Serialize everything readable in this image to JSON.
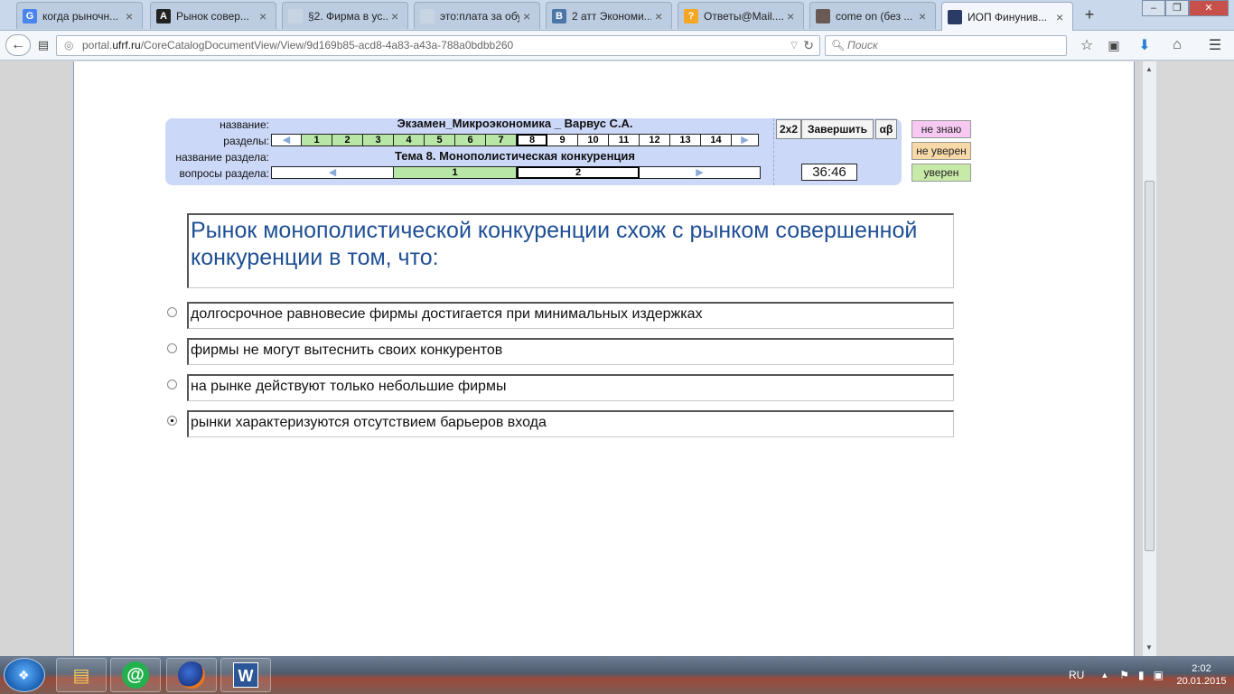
{
  "tabs": [
    {
      "label": "когда рыночн...",
      "fav": "G",
      "favcolor": "#4a84ee"
    },
    {
      "label": "Рынок совер...",
      "fav": "A",
      "favcolor": "#222222"
    },
    {
      "label": "§2. Фирма в ус...",
      "fav": "",
      "favcolor": "#c8d4e2"
    },
    {
      "label": "это:плата за обуч...",
      "fav": "",
      "favcolor": "#c8d4e2"
    },
    {
      "label": "2 атт Экономи...",
      "fav": "B",
      "favcolor": "#4d76a8"
    },
    {
      "label": "Ответы@Mail....",
      "fav": "?",
      "favcolor": "#f5a623"
    },
    {
      "label": "come on (без ...",
      "fav": "",
      "favcolor": "#6a5a55"
    },
    {
      "label": "ИОП Финунив...",
      "fav": "",
      "favcolor": "#2a3b66",
      "active": true
    }
  ],
  "new_tab_glyph": "+",
  "window_buttons": {
    "min": "–",
    "max": "❐",
    "close": "✕"
  },
  "url": {
    "prefix": "portal.",
    "domain": "ufrf.ru",
    "path": "/CoreCatalogDocumentView/View/9d169b85-acd8-4a83-a43a-788a0bdbb260"
  },
  "search_placeholder": "Поиск",
  "exam": {
    "label_name": "название:",
    "label_sections": "разделы:",
    "label_section_name": "название раздела:",
    "label_section_questions": "вопросы раздела:",
    "title": "Экзамен_Микроэкономика _ Варвус С.А.",
    "sections": [
      "1",
      "2",
      "3",
      "4",
      "5",
      "6",
      "7",
      "8",
      "9",
      "10",
      "11",
      "12",
      "13",
      "14"
    ],
    "sections_done": 7,
    "current_section": "8",
    "section_title": "Тема   8. Монополистическая конкуренция",
    "questions": [
      "1",
      "2"
    ],
    "current_question": "2",
    "btn_2x2": "2x2",
    "btn_finish": "Завершить",
    "btn_ab": "αβ",
    "timer": "36:46"
  },
  "confidence": [
    {
      "label": "не знаю",
      "color": "#f6c8f2"
    },
    {
      "label": "не уверен",
      "color": "#f7d9a8"
    },
    {
      "label": "уверен",
      "color": "#c8eaa8"
    }
  ],
  "question": "Рынок монополистической конкуренции схож с рынком совершенной конкуренции в том, что:",
  "options": [
    {
      "text": "долгосрочное равновесие фирмы достигается при минимальных издержках",
      "checked": false
    },
    {
      "text": "фирмы не могут вытеснить своих конкурентов",
      "checked": false
    },
    {
      "text": "на рынке действуют только небольшие фирмы",
      "checked": false
    },
    {
      "text": "рынки характеризуются отсутствием барьеров входа",
      "checked": true
    }
  ],
  "taskbar": {
    "apps": [
      "explorer-icon",
      "mail-agent-icon",
      "firefox-icon",
      "word-icon"
    ],
    "word_glyph": "W",
    "mail_glyph": "@",
    "lang": "RU",
    "time": "2:02",
    "date": "20.01.2015"
  }
}
